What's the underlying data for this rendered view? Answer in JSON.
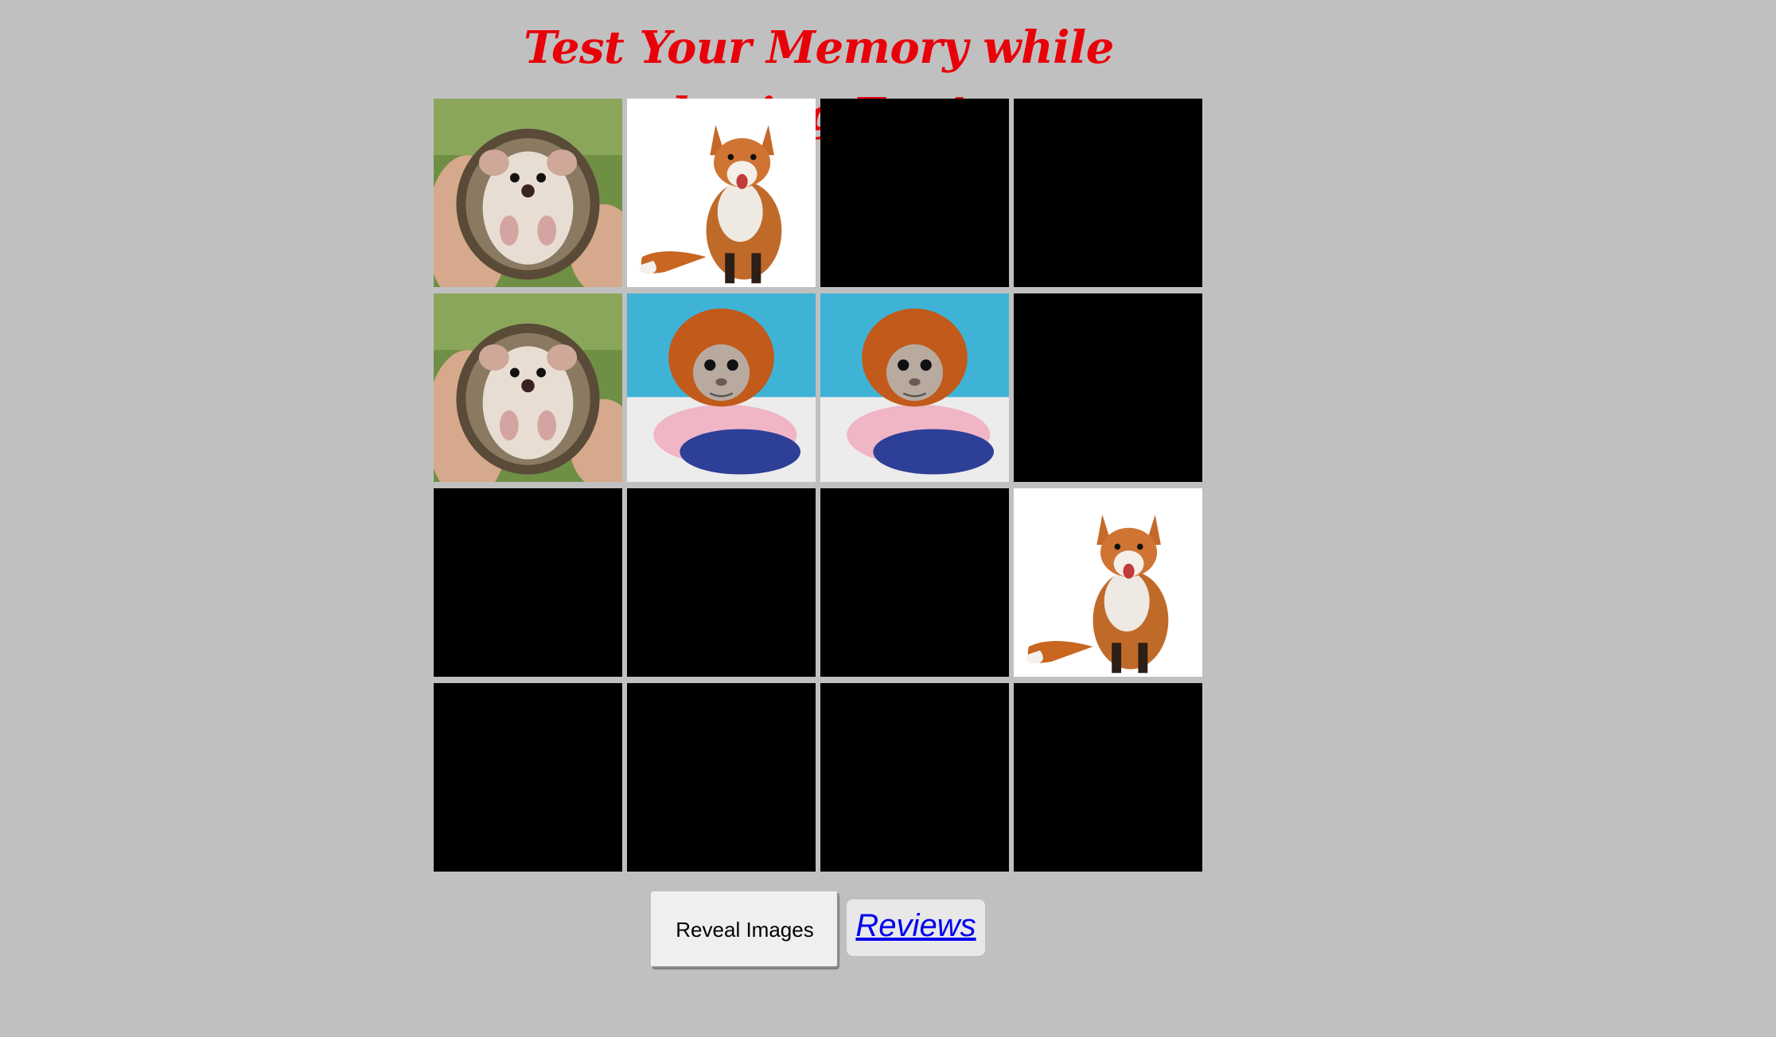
{
  "page": {
    "title": "Test Your Memory while having Fun!",
    "title_color": "#e8000a",
    "background": "#c0c0c0"
  },
  "cards": [
    {
      "state": "revealed",
      "image": "hedgehog"
    },
    {
      "state": "revealed",
      "image": "fox"
    },
    {
      "state": "hidden"
    },
    {
      "state": "hidden"
    },
    {
      "state": "revealed",
      "image": "hedgehog"
    },
    {
      "state": "revealed",
      "image": "monkey"
    },
    {
      "state": "revealed",
      "image": "monkey"
    },
    {
      "state": "hidden"
    },
    {
      "state": "hidden"
    },
    {
      "state": "hidden"
    },
    {
      "state": "hidden"
    },
    {
      "state": "revealed",
      "image": "fox"
    },
    {
      "state": "hidden"
    },
    {
      "state": "hidden"
    },
    {
      "state": "hidden"
    },
    {
      "state": "hidden"
    }
  ],
  "controls": {
    "reveal_label": "Reveal Images",
    "reviews_label": "Reviews"
  },
  "colors": {
    "card_back": "#000000",
    "link": "#0000ee"
  }
}
